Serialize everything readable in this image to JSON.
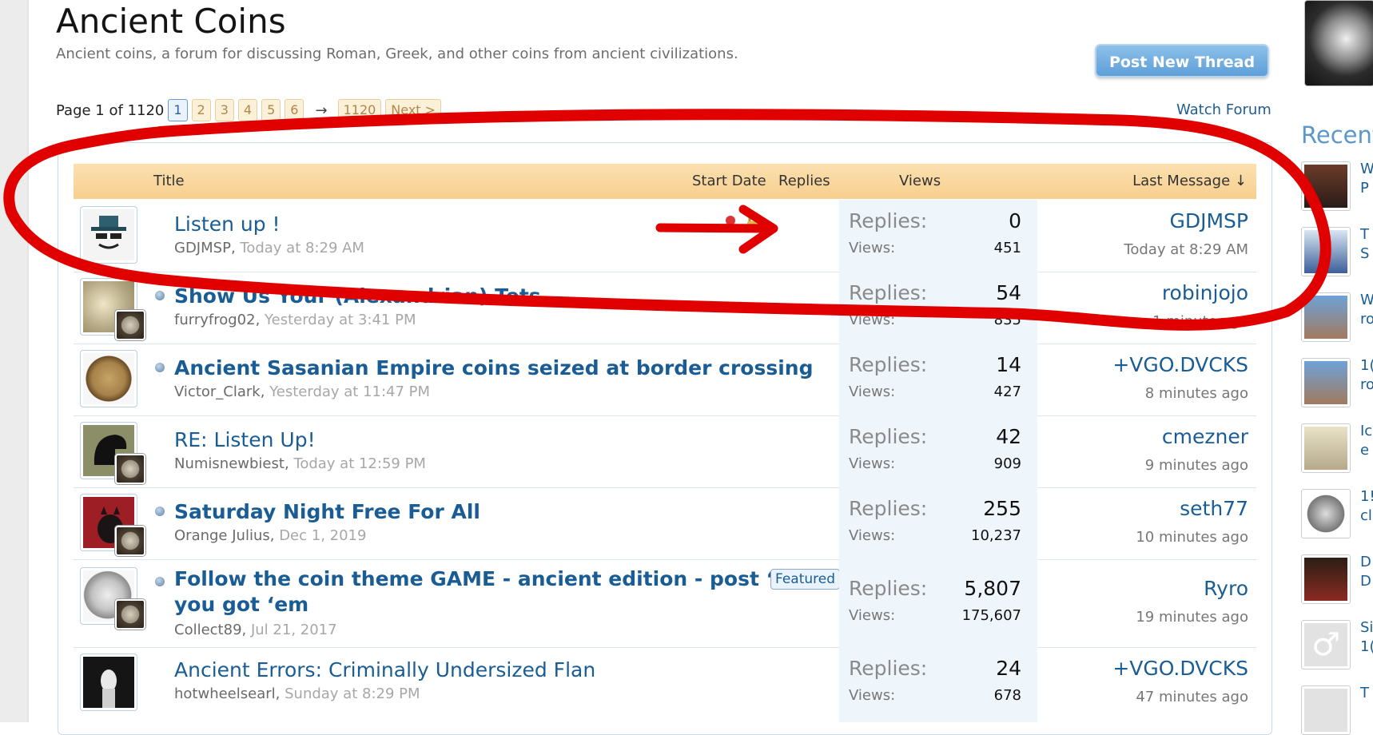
{
  "forum": {
    "title": "Ancient Coins",
    "description": "Ancient coins, a forum for discussing Roman, Greek, and other coins from ancient civilizations.",
    "post_button": "Post New Thread",
    "watch_label": "Watch Forum"
  },
  "pager": {
    "label": "Page 1 of 1120",
    "pages": [
      "1",
      "2",
      "3",
      "4",
      "5",
      "6"
    ],
    "arrow": "→",
    "last": "1120",
    "next": "Next >"
  },
  "columns": {
    "title": "Title",
    "start_date": "Start Date",
    "replies": "Replies",
    "views": "Views",
    "last_message": "Last Message ↓"
  },
  "stat_labels": {
    "replies": "Replies:",
    "views": "Views:"
  },
  "threads": [
    {
      "title": "Listen up !",
      "author": "GDJMSP",
      "date": "Today at 8:29 AM",
      "replies": "0",
      "views": "451",
      "last_user": "GDJMSP",
      "last_time": "Today at 8:29 AM"
    },
    {
      "title": "Show Us Your (Alexandrian) Tets",
      "author": "furryfrog02",
      "date": "Yesterday at 3:41 PM",
      "replies": "54",
      "views": "835",
      "last_user": "robinjojo",
      "last_time": "1 minute ago"
    },
    {
      "title": "Ancient Sasanian Empire coins seized at border crossing",
      "author": "Victor_Clark",
      "date": "Yesterday at 11:47 PM",
      "replies": "14",
      "views": "427",
      "last_user": "+VGO.DVCKS",
      "last_time": "8 minutes ago"
    },
    {
      "title": "RE: Listen Up!",
      "author": "Numisnewbiest",
      "date": "Today at 12:59 PM",
      "replies": "42",
      "views": "909",
      "last_user": "cmezner",
      "last_time": "9 minutes ago"
    },
    {
      "title": "Saturday Night Free For All",
      "author": "Orange Julius",
      "date": "Dec 1, 2019",
      "replies": "255",
      "views": "10,237",
      "last_user": "seth77",
      "last_time": "10 minutes ago"
    },
    {
      "title_line1": "Follow the coin theme GAME - ancient edition - post ‘em if",
      "title_line2": "you got ‘em",
      "badge": "Featured",
      "author": "Collect89",
      "date": "Jul 21, 2017",
      "replies": "5,807",
      "views": "175,607",
      "last_user": "Ryro",
      "last_time": "19 minutes ago"
    },
    {
      "title": "Ancient Errors: Criminally Undersized Flan",
      "author": "hotwheelsearl",
      "date": "Sunday at 8:29 PM",
      "replies": "24",
      "views": "678",
      "last_user": "+VGO.DVCKS",
      "last_time": "47 minutes ago"
    }
  ],
  "sidebar": {
    "heading": "Recent",
    "items": [
      "W P",
      "T S",
      "W ro",
      "1( ro",
      "Ic e",
      "1! cl",
      "D D",
      "Si 1(",
      "T"
    ]
  },
  "colors": {
    "link": "#1a5d94",
    "header_bg": "#f7cf8e",
    "annotation": "#e00000",
    "stats_bg": "#eef5fb"
  },
  "icons": {
    "sticky": "pushpin-icon",
    "locked": "lock-icon",
    "unread": "unread-dot-icon"
  }
}
